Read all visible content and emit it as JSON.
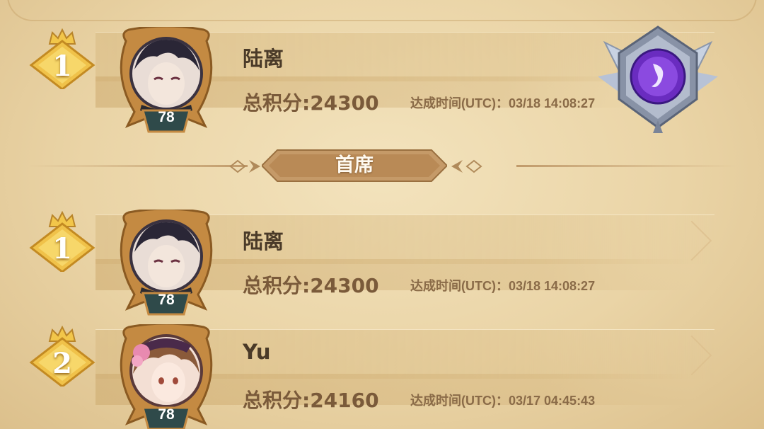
{
  "top_entry": {
    "rank": "1",
    "name": "陆离",
    "level": "78",
    "score": "总积分:24300",
    "time": "达成时间(UTC)：03/18 14:08:27",
    "emblem_icon": "purple-crest-emblem-icon"
  },
  "section_title": "首席",
  "entries": [
    {
      "rank": "1",
      "name": "陆离",
      "level": "78",
      "score": "总积分:24300",
      "time": "达成时间(UTC)：03/18 14:08:27"
    },
    {
      "rank": "2",
      "name": "Yu",
      "level": "78",
      "score": "总积分:24160",
      "time": "达成时间(UTC)：03/17 04:45:43"
    }
  ],
  "colors": {
    "parchment": "#ead4a6",
    "gold": "#e8b43a",
    "bronze_frame": "#b07a3a",
    "level_badge": "#2f4a4a",
    "emblem_purple": "#7a3cc8"
  }
}
